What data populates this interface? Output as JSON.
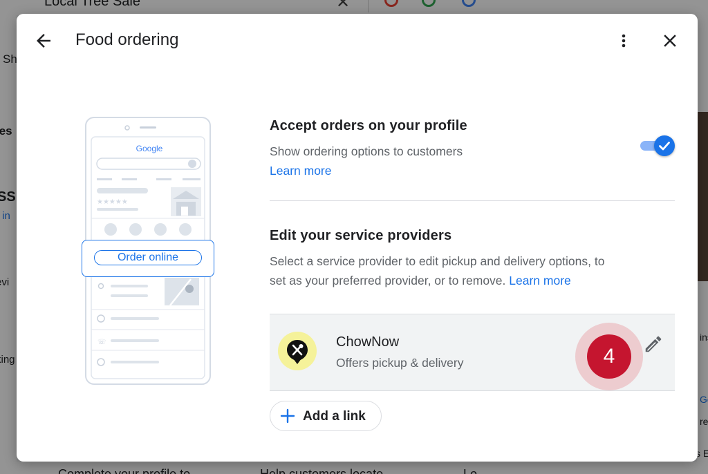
{
  "background_page": {
    "search_text": "Local Tree Sale",
    "left_fragments": [
      "Sh",
      "les",
      "SS",
      "r in",
      "evi",
      "king"
    ],
    "right_fragments": [
      "ins",
      "Go",
      "re",
      "s E"
    ],
    "bottom_fragments": [
      "Complete your profile to",
      "Help customers locate",
      "Lo"
    ]
  },
  "dialog": {
    "title": "Food ordering"
  },
  "illustration": {
    "google_wordmark": "Google",
    "order_online_label": "Order online"
  },
  "accept_orders": {
    "title": "Accept orders on your profile",
    "description": "Show ordering options to customers",
    "learn_more": "Learn more",
    "toggle_on": true
  },
  "providers_section": {
    "title": "Edit your service providers",
    "description_line1": "Select a service provider to edit pickup and delivery options, to",
    "description_line2": "set as your preferred provider, or to remove.",
    "learn_more": "Learn more"
  },
  "provider": {
    "name": "ChowNow",
    "subtitle": "Offers pickup & delivery",
    "step_badge": "4"
  },
  "add_link": {
    "label": "Add a link"
  },
  "colors": {
    "accent": "#1a73e8",
    "badge": "#c5152f",
    "provider_logo_bg": "#f5f29a"
  }
}
